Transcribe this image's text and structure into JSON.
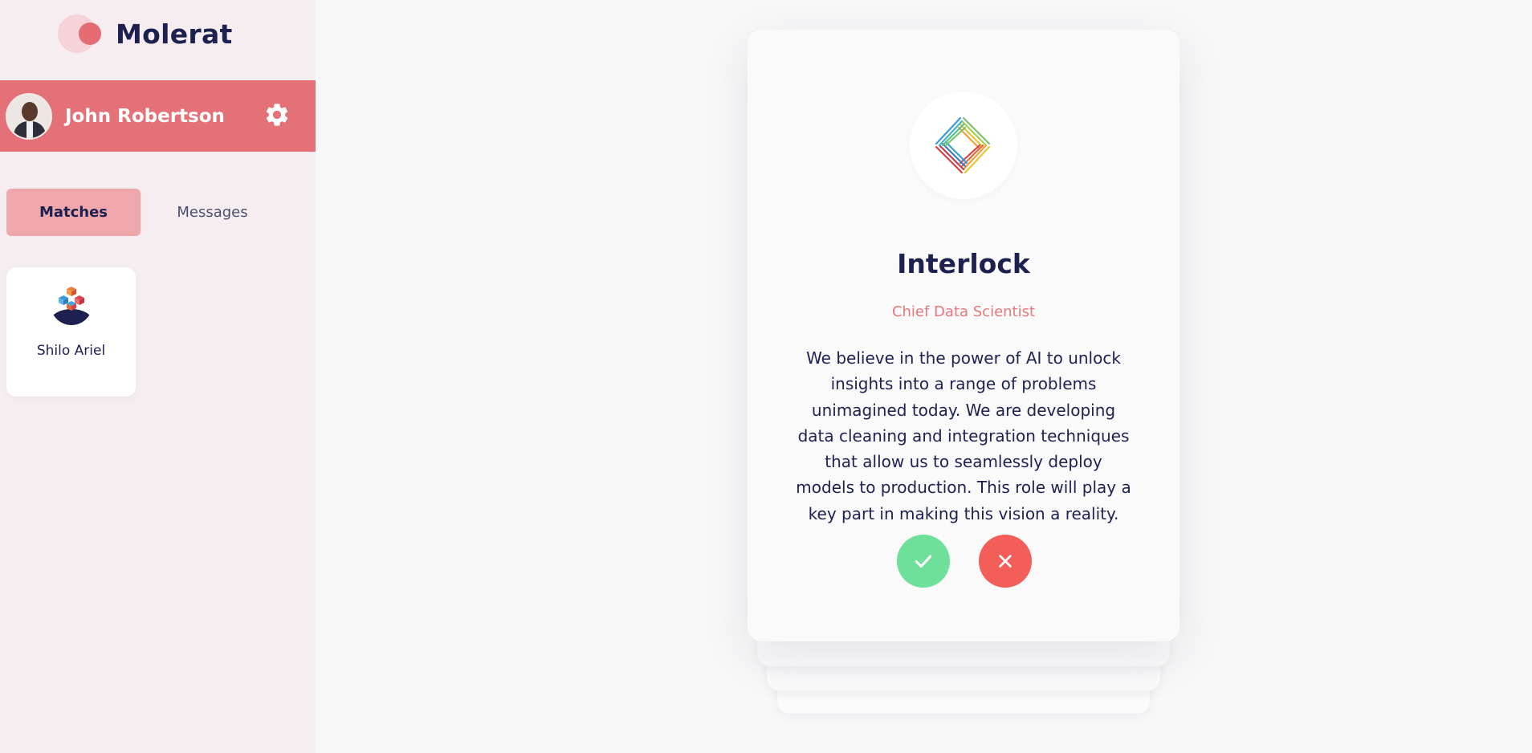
{
  "app": {
    "name": "Molerat"
  },
  "user": {
    "name": "John Robertson",
    "settings_icon": "gear-icon"
  },
  "tabs": [
    {
      "label": "Matches",
      "active": true
    },
    {
      "label": "Messages",
      "active": false
    }
  ],
  "matches": [
    {
      "name": "Shilo Ariel",
      "logo_icon": "cube-logo-icon"
    }
  ],
  "job_card": {
    "company": "Interlock",
    "role": "Chief Data Scientist",
    "description": "We believe in the power of AI to unlock insights into a range of problems unimagined today. We are developing data cleaning and integration techniques that allow us to seamlessly deploy models to production. This role will play a key part in making this vision a reality.",
    "accept_icon": "check-icon",
    "reject_icon": "close-icon"
  },
  "colors": {
    "brand": "#e56c72",
    "sidebar_bg": "#f5edef",
    "active_tab": "#efa7ac",
    "accept": "#6ee09a",
    "reject": "#f45e58",
    "text_dark": "#1c2150"
  }
}
